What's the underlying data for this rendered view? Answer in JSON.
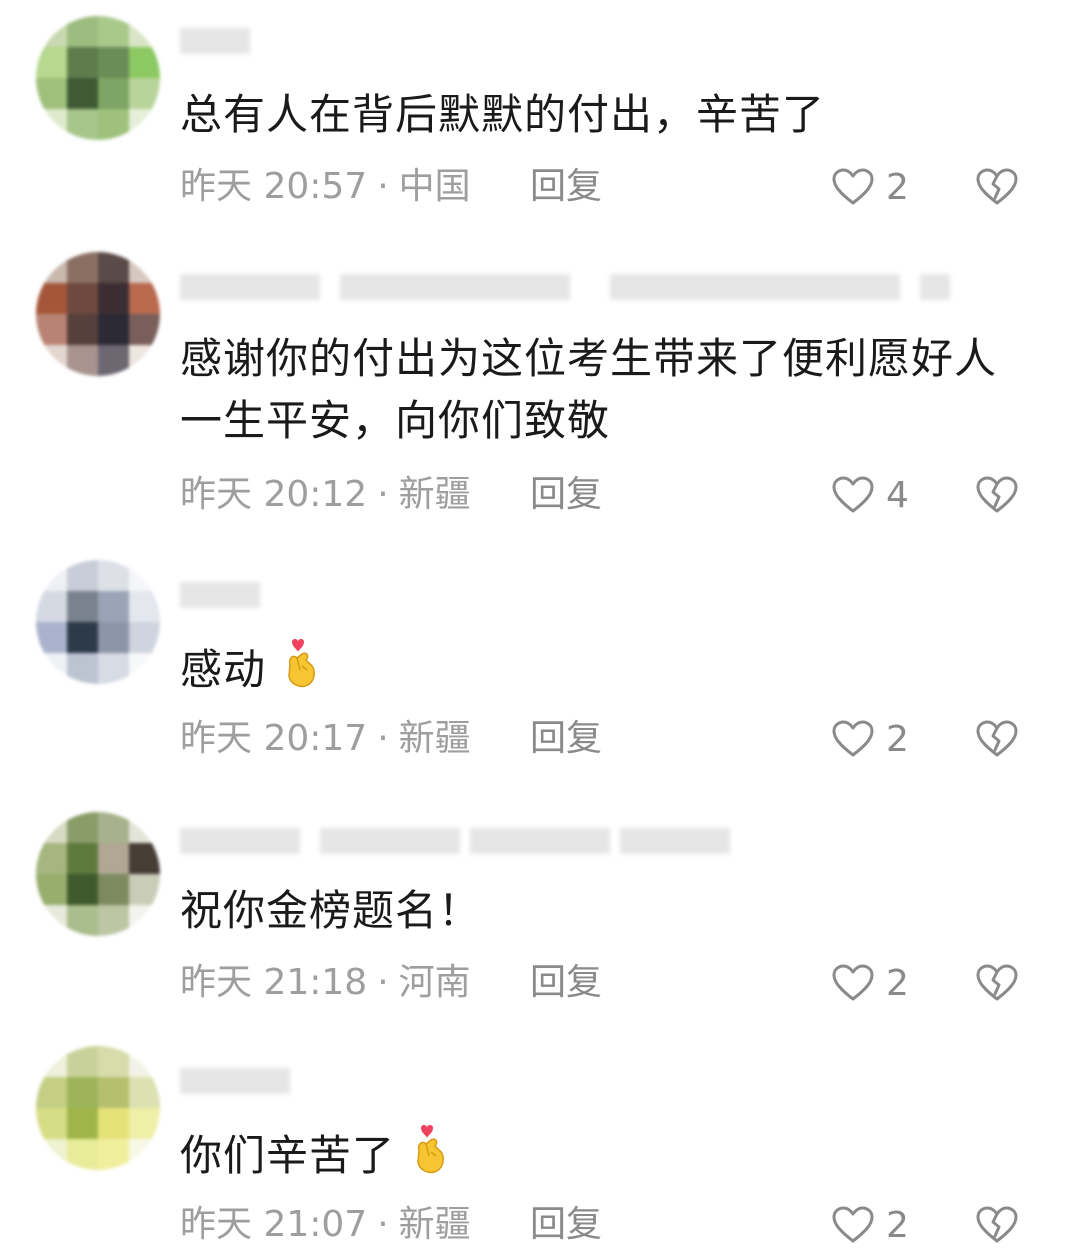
{
  "comments": [
    {
      "text": "总有人在背后默默的付出，辛苦了",
      "time": "昨天 20:57",
      "location": "中国",
      "reply": "回复",
      "likes": "2"
    },
    {
      "text": "感谢你的付出为这位考生带来了便利愿好人一生平安，向你们致敬",
      "time": "昨天 20:12",
      "location": "新疆",
      "reply": "回复",
      "likes": "4"
    },
    {
      "text": "感动",
      "time": "昨天 20:17",
      "location": "新疆",
      "reply": "回复",
      "likes": "2"
    },
    {
      "text": "祝你金榜题名！",
      "time": "昨天 21:18",
      "location": "河南",
      "reply": "回复",
      "likes": "2"
    },
    {
      "text": "你们辛苦了",
      "time": "昨天 21:07",
      "location": "新疆",
      "reply": "回复",
      "likes": "2"
    }
  ],
  "separator": "·",
  "icons": {
    "like": "heart-outline-icon",
    "dislike": "broken-heart-icon",
    "emoji": "finger-heart-emoji"
  },
  "colors": {
    "text": "#1a1a1a",
    "meta": "#9e9e9e",
    "icon": "#8a8a8a",
    "emoji_heart": "#f0425f",
    "emoji_hand": "#f7c531"
  }
}
